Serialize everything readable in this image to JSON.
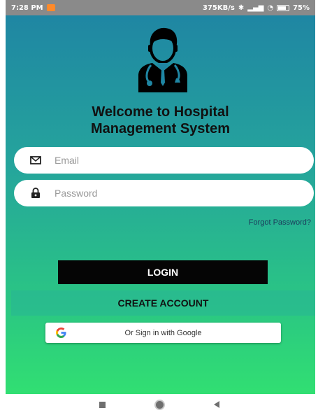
{
  "status_bar": {
    "time": "7:28 PM",
    "network_speed": "375KB/s",
    "battery": "75%"
  },
  "header": {
    "icon": "doctor-icon",
    "title_line1": "Welcome to Hospital",
    "title_line2": "Management System"
  },
  "form": {
    "email_placeholder": "Email",
    "email_value": "",
    "email_icon": "envelope-icon",
    "password_placeholder": "Password",
    "password_value": "",
    "password_icon": "lock-icon",
    "forgot_label": "Forgot Password?"
  },
  "actions": {
    "login_label": "LOGIN",
    "create_label": "CREATE ACCOUNT",
    "google_label": "Or Sign in with Google",
    "google_icon": "google-logo-icon"
  },
  "navigation": [
    "recents-button",
    "home-button",
    "back-button"
  ],
  "colors": {
    "gradient_top": "#1f86a3",
    "gradient_bottom": "#31df72",
    "login_bg": "#050505",
    "field_bg": "#ffffff",
    "status_bar_bg": "#8a8a8a"
  }
}
